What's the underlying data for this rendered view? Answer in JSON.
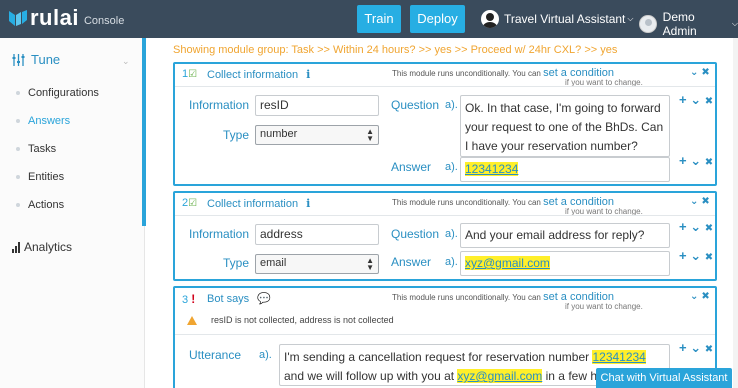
{
  "app": {
    "logo_text": "rulai",
    "logo_sub": "Console"
  },
  "toolbar": {
    "train": "Train",
    "deploy": "Deploy",
    "assistant": "Travel Virtual Assistant",
    "user": "Demo Admin"
  },
  "sidebar": {
    "tune_label": "Tune",
    "items": [
      {
        "label": "Configurations",
        "active": false
      },
      {
        "label": "Answers",
        "active": true
      },
      {
        "label": "Tasks",
        "active": false
      },
      {
        "label": "Entities",
        "active": false
      },
      {
        "label": "Actions",
        "active": false
      }
    ],
    "analytics_label": "Analytics"
  },
  "breadcrumb": "Showing module group:  Task  >> Within 24 hours?  >> yes  >> Proceed w/ 24hr CXL?  >> yes",
  "modules": [
    {
      "num": "1",
      "title": "Collect information",
      "cond_text": "This module runs unconditionally. You can",
      "cond_link": "set a condition",
      "cond_sub": "if you want to change.",
      "info_label": "Information",
      "info_value": "resID",
      "type_label": "Type",
      "type_value": "number",
      "question_label": "Question",
      "question_a": "a).",
      "question_text": "Ok. In that case, I'm going to forward your request to one of the BhDs.  Can I have your reservation number?",
      "answer_label": "Answer",
      "answer_a": "a).",
      "answer_text": "12341234"
    },
    {
      "num": "2",
      "title": "Collect information",
      "cond_text": "This module runs unconditionally. You can",
      "cond_link": "set a condition",
      "cond_sub": "if you want to change.",
      "info_label": "Information",
      "info_value": "address",
      "type_label": "Type",
      "type_value": "email",
      "question_label": "Question",
      "question_a": "a).",
      "question_text": "And your email address for reply?",
      "answer_label": "Answer",
      "answer_a": "a).",
      "answer_text": "xyz@gmail.com"
    },
    {
      "num": "3",
      "title": "Bot says",
      "cond_text": "This module runs unconditionally. You can",
      "cond_link": "set a condition",
      "cond_sub": "if you want to change.",
      "warning": "resID is not collected, address is not collected",
      "utterance_label": "Utterance",
      "utterance_a": "a).",
      "utterance_pre": "I'm sending a cancellation request for reservation number ",
      "utterance_hl1": "12341234",
      "utterance_mid": " and we will follow up with you at ",
      "utterance_hl2": "xyz@gmail.com",
      "utterance_post": " in a few hours."
    }
  ],
  "chat_button": "Chat with Virtual Assistant",
  "colors": {
    "topbar": "#3a4b5c",
    "accent": "#2aa4da",
    "breadcrumb": "#f0a531",
    "highlight": "#ffef2a"
  }
}
